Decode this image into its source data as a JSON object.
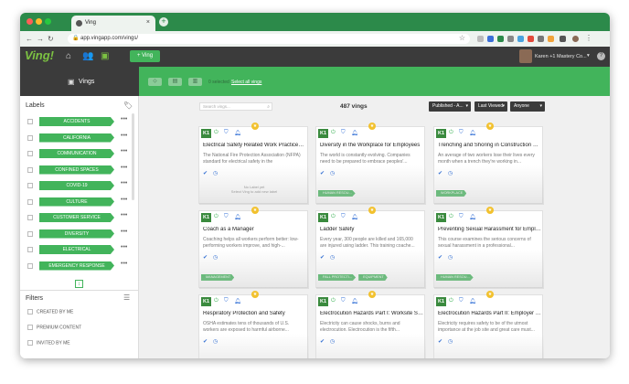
{
  "colors": {
    "brand_green": "#42b45b",
    "dark": "#3b3b3b",
    "chrome_green": "#2c8a4a",
    "star": "#f2c12e",
    "k1": "#3a8a3e"
  },
  "browser": {
    "tab_title": "Ving",
    "tab_close": "×",
    "new_tab": "+",
    "url": "app.vingapp.com/vings/"
  },
  "header": {
    "logo": "Ving!",
    "new_ving_label": "+ Ving",
    "user_label": "Karen +1 Mastery Co...",
    "help": "?"
  },
  "sidebar": {
    "section_title": "Vings",
    "labels_title": "Labels",
    "labels": [
      "ACCIDENTS",
      "CALIFORNIA",
      "COMMUNICATION",
      "CONFINED SPACES",
      "COVID-19",
      "CULTURE",
      "CUSTOMER SERVICE",
      "DIVERSITY",
      "ELECTRICAL",
      "EMERGENCY RESPONSE"
    ],
    "more": "•••",
    "filters_title": "Filters",
    "filters": [
      "CREATED BY ME",
      "PREMIUM CONTENT",
      "INVITED BY ME"
    ]
  },
  "toolbar": {
    "selected": "0 selected",
    "select_all": "Select all vings"
  },
  "list": {
    "search_placeholder": "Search vings...",
    "count": "487 vings",
    "filter_published": "Published - A...",
    "filter_sort": "Last Viewed",
    "filter_owner": "Anyone"
  },
  "cards": [
    {
      "title": "Electrical Safety Related Work Practices ...",
      "desc": "The National Fire Protection Association (NFPA) standard for electrical safety in the",
      "labels": [],
      "no_label": "No Label yet\nSelect Ving to add new label"
    },
    {
      "title": "Diversity in the Workplace for Employees",
      "desc": "The world is constantly evolving. Companies need to be prepared to embrace peoples'...",
      "labels": [
        "HUMAN RESOU..."
      ]
    },
    {
      "title": "Trenching and Shoring in Construction En...",
      "desc": "An average of two workers lose their lives every month when a trench they're working in...",
      "labels": [
        "WORKPLACE"
      ]
    },
    {
      "title": "Coach as a Manager",
      "desc": "Coaching helps all workers perform better: low-performing workers improve, and high-...",
      "labels": [
        "MANAGEMENT"
      ]
    },
    {
      "title": "Ladder Safety",
      "desc": "Every year, 300 people are killed and 165,000 are injured using ladder. This training coache...",
      "labels": [
        "FALL PROTECTI...",
        "EQUIPMENT"
      ]
    },
    {
      "title": "Preventing Sexual Harassment for Employ...",
      "desc": "This course examines the serious concerns of sexual harassment in a professional...",
      "labels": [
        "HUMAN RESOU..."
      ]
    },
    {
      "title": "Respiratory Protection and Safety",
      "desc": "OSHA estimates tens of thousands of U.S. workers are exposed to harmful airborne...",
      "labels": [
        "PPE"
      ]
    },
    {
      "title": "Electrocution Hazards Part I: Worksite Sa...",
      "desc": "Electricity can cause shocks, burns and electrocution. Electrocution is the fifth...",
      "labels": [
        "ELECTRICAL"
      ]
    },
    {
      "title": "Electrocution Hazards Part II: Employer R...",
      "desc": "Electricity requires safety to be of the utmost importance at the job site and great care must...",
      "labels": [
        "ELECTRICAL"
      ]
    }
  ],
  "card_badge": "K1"
}
